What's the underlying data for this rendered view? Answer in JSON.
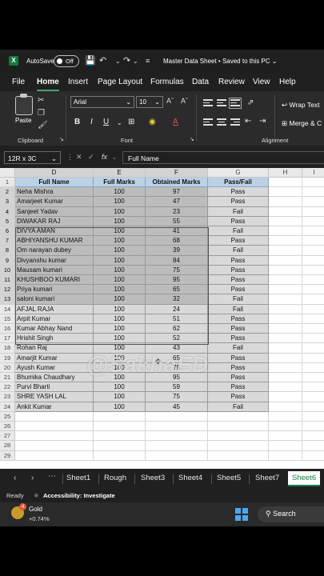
{
  "titlebar": {
    "logo": "X",
    "autosave_label": "AutoSave",
    "autosave_state": "Off",
    "doc_title": "Master Data Sheet • Saved to this PC ⌄"
  },
  "menu": [
    "File",
    "Home",
    "Insert",
    "Page Layout",
    "Formulas",
    "Data",
    "Review",
    "View",
    "Help"
  ],
  "ribbon": {
    "paste_label": "Paste",
    "clipboard_label": "Clipboard",
    "font_label": "Font",
    "alignment_label": "Alignment",
    "font_name": "Arial",
    "font_size": "10",
    "bold": "B",
    "italic": "I",
    "underline": "U",
    "wrap_text": "Wrap Text",
    "merge": "Merge & C"
  },
  "formula_bar": {
    "name_box": "12R x 3C",
    "fx": "fx",
    "value": "Full Name"
  },
  "columns": [
    "D",
    "E",
    "F",
    "G",
    "H",
    "I"
  ],
  "table": {
    "headers": [
      "Full Name",
      "Full Marks",
      "Obtained Marks",
      "Pass/Fail"
    ],
    "rows": [
      [
        "Neha Mishra",
        "100",
        "97",
        "Pass"
      ],
      [
        "Amarjeet Kumar",
        "100",
        "47",
        "Pass"
      ],
      [
        "Sanjeet Yadav",
        "100",
        "23",
        "Fail"
      ],
      [
        "DIWAKAR RAJ",
        "100",
        "55",
        "Pass"
      ],
      [
        "DIVYA AMAN",
        "100",
        "41",
        "Fail"
      ],
      [
        "ABHIYANSHU KUMAR",
        "100",
        "68",
        "Pass"
      ],
      [
        "Om narayan dubey",
        "100",
        "39",
        "Fail"
      ],
      [
        "Divyanshu kumar",
        "100",
        "84",
        "Pass"
      ],
      [
        "Mausam kumari",
        "100",
        "75",
        "Pass"
      ],
      [
        "KHUSHBOO KUMARI",
        "100",
        "95",
        "Pass"
      ],
      [
        "Priya kumari",
        "100",
        "65",
        "Pass"
      ],
      [
        "saloni kumari",
        "100",
        "32",
        "Fail"
      ],
      [
        "AFJAL RAJA",
        "100",
        "24",
        "Fail"
      ],
      [
        "Arpit Kumar",
        "100",
        "51",
        "Pass"
      ],
      [
        "Kumar Abhay Nand",
        "100",
        "62",
        "Pass"
      ],
      [
        "Hrishit Singh",
        "100",
        "52",
        "Pass"
      ],
      [
        "Rohan Raj",
        "100",
        "43",
        "Fail"
      ],
      [
        "Amarjit Kumar",
        "100",
        "65",
        "Pass"
      ],
      [
        "Ayush Kumar",
        "100",
        "75",
        "Pass"
      ],
      [
        "Bhumika Chaudhary",
        "100",
        "95",
        "Pass"
      ],
      [
        "Purvi Bharti",
        "100",
        "59",
        "Pass"
      ],
      [
        "SHRE YASH LAL",
        "100",
        "75",
        "Pass"
      ],
      [
        "Ankit Kumar",
        "100",
        "45",
        "Fail"
      ]
    ]
  },
  "watermark": "@SakhaED",
  "sheet_tabs": [
    "Sheet1",
    "Rough",
    "Sheet3",
    "Sheet4",
    "Sheet5",
    "Sheet7",
    "Sheet6"
  ],
  "active_sheet": "Sheet6",
  "status": {
    "ready": "Ready",
    "accessibility": "Accessibility: Investigate"
  },
  "taskbar": {
    "badge": "4",
    "ticker_name": "Gold",
    "ticker_change": "+0.74%",
    "search_label": "Search"
  }
}
